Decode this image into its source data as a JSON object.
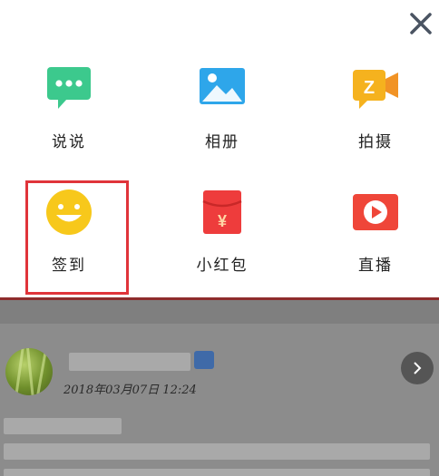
{
  "share_sheet": {
    "items": [
      {
        "label": "说说",
        "icon": "message-icon",
        "color": "#3cc98d"
      },
      {
        "label": "相册",
        "icon": "photo-album-icon",
        "color": "#2ea6ea"
      },
      {
        "label": "拍摄",
        "icon": "video-camera-icon",
        "color": "#f5b21e"
      },
      {
        "label": "签到",
        "icon": "smiley-icon",
        "color": "#f7c81b"
      },
      {
        "label": "小红包",
        "icon": "red-envelope-icon",
        "color": "#ee3c3c"
      },
      {
        "label": "直播",
        "icon": "live-play-icon",
        "color": "#ef4639"
      }
    ],
    "highlight_color": "#e0343a"
  },
  "feed_post": {
    "timestamp": "2018年03月07日 12:24"
  }
}
